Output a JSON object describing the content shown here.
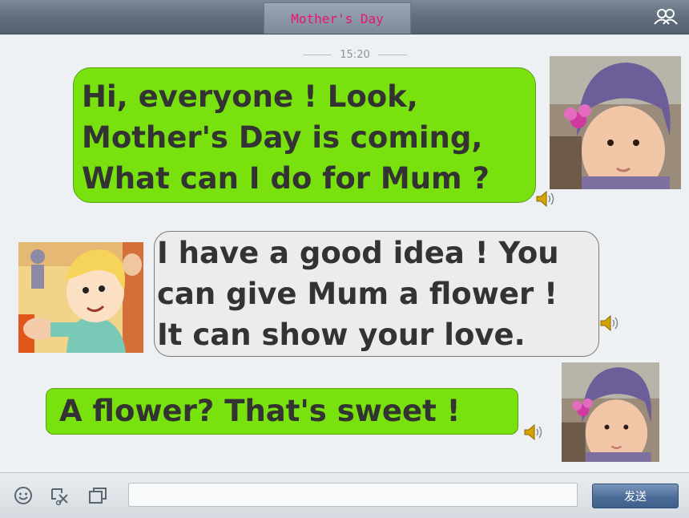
{
  "window": {
    "title": "Mother's Day"
  },
  "chat": {
    "timestamp": "15:20",
    "messages": [
      {
        "sender": "girl",
        "text": "Hi, everyone ! Look,\nMother's Day is coming,\nWhat can I do for Mum ?"
      },
      {
        "sender": "boy",
        "text": "I have a good idea ! You\ncan give Mum a flower !\nIt can show your love."
      },
      {
        "sender": "girl",
        "text": "A flower? That's sweet !"
      }
    ]
  },
  "input": {
    "value": "",
    "placeholder": ""
  },
  "toolbar": {
    "send_label": "发送"
  },
  "icons": {
    "contacts": "contacts-icon",
    "emoji": "smiley-icon",
    "screenshot": "scissors-icon",
    "window": "window-icon",
    "speaker": "speaker-icon"
  },
  "colors": {
    "title_text": "#e8127a",
    "my_bubble": "#78e10e",
    "their_bubble": "#ececec",
    "send_button": "#4d6d99"
  }
}
